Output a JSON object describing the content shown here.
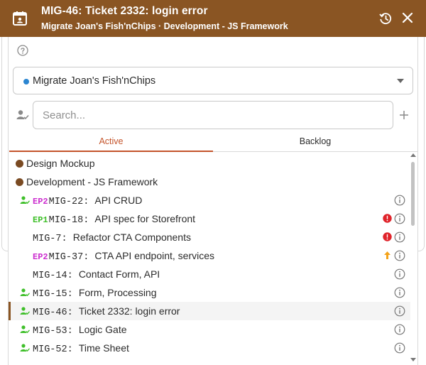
{
  "header": {
    "title": "MIG-46: Ticket 2332: login error",
    "subtitle": "Migrate Joan's Fish'nChips · Development - JS Framework",
    "icons": [
      "calendar-icon",
      "history-icon",
      "close-icon"
    ],
    "bg_color": "#8a5523"
  },
  "project_select": {
    "value": "Migrate Joan's Fish'nChips",
    "dot_color": "#2c86d1"
  },
  "search": {
    "placeholder": "Search...",
    "value": ""
  },
  "tabs": [
    {
      "label": "Active",
      "active": true
    },
    {
      "label": "Backlog",
      "active": false
    }
  ],
  "colors": {
    "accent": "#c4542b",
    "brown": "#7a4a22",
    "epic2": "#cc2fcf",
    "epic1": "#3fbf2a",
    "alert": "#e0242b",
    "priority_up": "#f4a31a",
    "assigned": "#3fbf2a"
  },
  "list": [
    {
      "type": "group",
      "name": "Design Mockup"
    },
    {
      "type": "group",
      "name": "Development - JS Framework"
    },
    {
      "type": "task",
      "assigned": true,
      "epic": "EP2",
      "key": "MIG-22",
      "title": "API CRUD",
      "flag": null
    },
    {
      "type": "task",
      "assigned": false,
      "epic": "EP1",
      "key": "MIG-18",
      "title": "API spec for Storefront",
      "flag": "alert"
    },
    {
      "type": "task",
      "assigned": false,
      "epic": null,
      "key": "MIG-7",
      "title": "Refactor CTA Components",
      "flag": "alert"
    },
    {
      "type": "task",
      "assigned": false,
      "epic": "EP2",
      "key": "MIG-37",
      "title": "CTA API endpoint, services",
      "flag": "up"
    },
    {
      "type": "task",
      "assigned": false,
      "epic": null,
      "key": "MIG-14",
      "title": "Contact Form, API",
      "flag": null
    },
    {
      "type": "task",
      "assigned": true,
      "epic": null,
      "key": "MIG-15",
      "title": "Form, Processing",
      "flag": null
    },
    {
      "type": "task",
      "assigned": true,
      "epic": null,
      "key": "MIG-46",
      "title": "Ticket 2332: login error",
      "flag": null,
      "selected": true
    },
    {
      "type": "task",
      "assigned": true,
      "epic": null,
      "key": "MIG-53",
      "title": "Logic Gate",
      "flag": null
    },
    {
      "type": "task",
      "assigned": true,
      "epic": null,
      "key": "MIG-52",
      "title": "Time Sheet",
      "flag": null
    }
  ]
}
